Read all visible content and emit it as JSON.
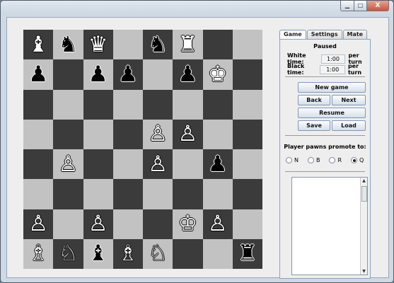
{
  "window_controls": {
    "minimize": "▭",
    "maximize": "▭",
    "close": "X"
  },
  "board": {
    "colors": {
      "dark": "#3b3b3b",
      "light": "#c2c2c2"
    },
    "squares": [
      [
        {
          "g": "♝",
          "c": "w"
        },
        {
          "g": "♞",
          "c": "b"
        },
        {
          "g": "♛",
          "c": "w"
        },
        null,
        {
          "g": "♞",
          "c": "b"
        },
        {
          "g": "♜",
          "c": "w"
        },
        null,
        null
      ],
      [
        {
          "g": "♟",
          "c": "b"
        },
        null,
        {
          "g": "♟",
          "c": "b"
        },
        {
          "g": "♟",
          "c": "b"
        },
        null,
        {
          "g": "♟",
          "c": "b"
        },
        {
          "g": "♚",
          "c": "w"
        },
        null
      ],
      [
        null,
        null,
        null,
        null,
        null,
        null,
        null,
        null
      ],
      [
        null,
        null,
        null,
        null,
        {
          "g": "♙",
          "c": "w"
        },
        {
          "g": "♙",
          "c": "w"
        },
        null,
        null
      ],
      [
        null,
        {
          "g": "♙",
          "c": "w"
        },
        null,
        null,
        {
          "g": "♙",
          "c": "w"
        },
        null,
        {
          "g": "♟",
          "c": "b"
        },
        null
      ],
      [
        null,
        null,
        null,
        null,
        null,
        null,
        null,
        null
      ],
      [
        {
          "g": "♙",
          "c": "w"
        },
        null,
        {
          "g": "♙",
          "c": "w"
        },
        null,
        null,
        {
          "g": "♔",
          "c": "w"
        },
        {
          "g": "♙",
          "c": "w"
        },
        null
      ],
      [
        {
          "g": "♗",
          "c": "w"
        },
        {
          "g": "♘",
          "c": "w"
        },
        {
          "g": "♝",
          "c": "b"
        },
        {
          "g": "♗",
          "c": "w"
        },
        {
          "g": "♘",
          "c": "w"
        },
        null,
        null,
        {
          "g": "♜",
          "c": "b"
        }
      ]
    ]
  },
  "tabs": [
    {
      "label": "Game",
      "active": true
    },
    {
      "label": "Settings",
      "active": false
    },
    {
      "label": "Mate",
      "active": false
    }
  ],
  "game": {
    "status": "Paused",
    "white_time_label": "White time:",
    "white_time_value": "1:00",
    "black_time_label": "Black time:",
    "black_time_value": "1:00",
    "per_turn": "per turn",
    "buttons": {
      "new_game": "New game",
      "back": "Back",
      "next": "Next",
      "resume": "Resume",
      "save": "Save",
      "load": "Load"
    },
    "promote_label": "Player pawns promote to:",
    "promote_options": [
      "N",
      "B",
      "R",
      "Q"
    ],
    "promote_selected": "Q",
    "log_text": ""
  }
}
